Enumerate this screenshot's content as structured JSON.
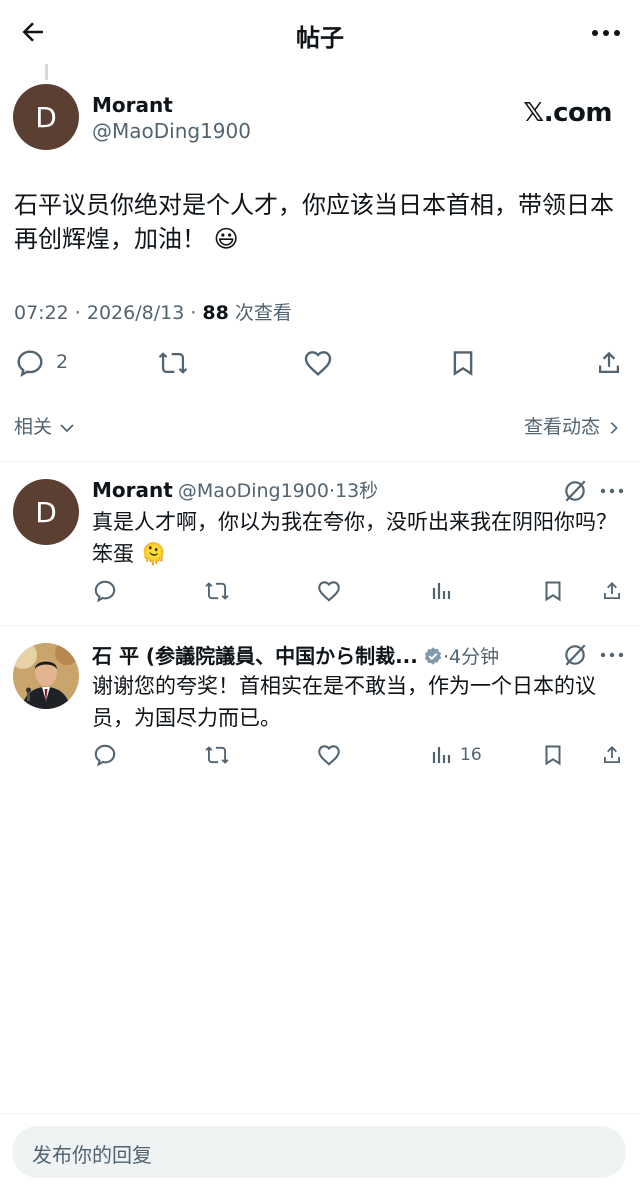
{
  "header": {
    "title": "帖子"
  },
  "main_post": {
    "name": "Morant",
    "handle": "@MaoDing1900",
    "avatar_letter": "D",
    "badge": "𝕏.com",
    "text": "石平议员你绝对是个人才，你应该当日本首相，带领日本再创辉煌，加油！",
    "emoji": "😃",
    "time": "07:22 · 2026/8/13 ·",
    "views": "88",
    "views_label": "次查看",
    "reply_count": "2"
  },
  "related": {
    "label": "相关",
    "chevron": "chevron-down-icon"
  },
  "view_activity": "查看动态",
  "replies": [
    {
      "name": "Morant",
      "handle": "@MaoDing1900",
      "time": "·13秒",
      "avatar_letter": "D",
      "text": "真是人才啊，你以为我在夸你，没听出来我在阴阳你吗？笨蛋",
      "emoji": "🫠",
      "views": ""
    },
    {
      "name": "石 平 (参議院議員、中国から制裁...",
      "handle": "",
      "time": "·4分钟",
      "verified": true,
      "text": "谢谢您的夸奖！首相实在是不敢当，作为一个日本的议员，为国尽力而已。",
      "views": "16"
    }
  ],
  "composer": {
    "placeholder": "发布你的回复"
  },
  "colors": {
    "text": "#0f1419",
    "secondary": "#536471",
    "avatar": "#5a3f32",
    "divider": "#eff3f4"
  }
}
